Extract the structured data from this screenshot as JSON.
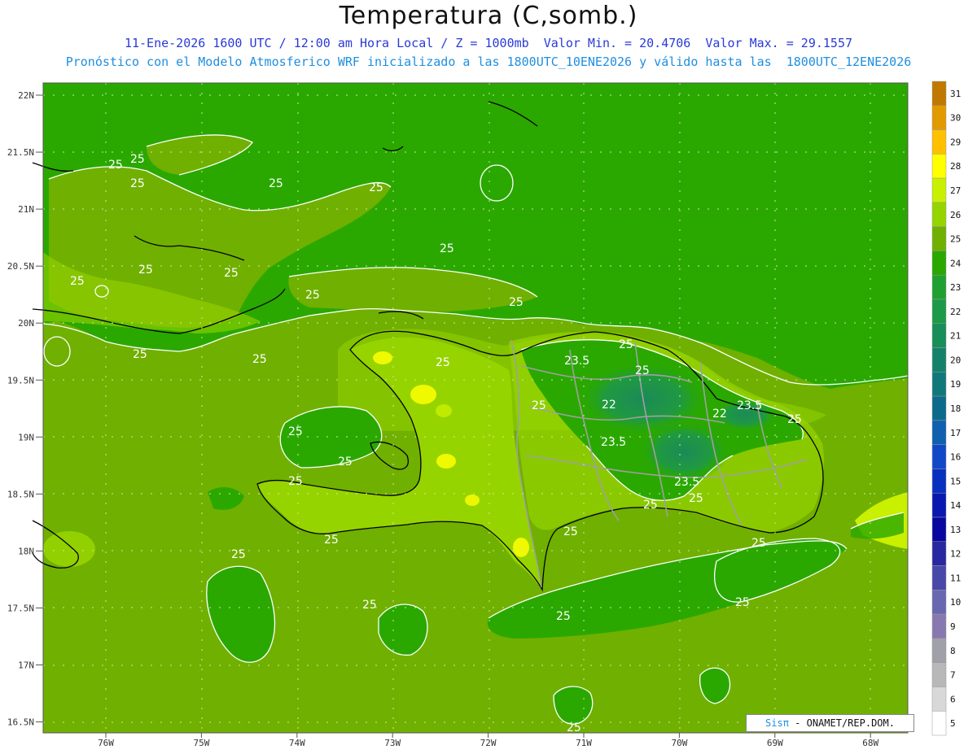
{
  "header": {
    "title": "Temperatura (C,somb.)",
    "subtitle1": "11-Ene-2026 1600 UTC / 12:00 am Hora Local / Z = 1000mb  Valor Min. = 20.4706  Valor Max. = 29.1557",
    "subtitle2": "Pronóstico con el Modelo Atmosferico WRF inicializado a las 1800UTC_10ENE2026 y válido hasta las  1800UTC_12ENE2026"
  },
  "axes": {
    "lat_labels": [
      "22N",
      "21.5N",
      "21N",
      "20.5N",
      "20N",
      "19.5N",
      "19N",
      "18.5N",
      "18N",
      "17.5N",
      "17N",
      "16.5N"
    ],
    "lon_labels": [
      "76W",
      "75W",
      "74W",
      "73W",
      "72W",
      "71W",
      "70W",
      "69W",
      "68W"
    ],
    "lat_values": [
      22,
      21.5,
      21,
      20.5,
      20,
      19.5,
      19,
      18.5,
      18,
      17.5,
      17,
      16.5
    ],
    "lon_values": [
      -76,
      -75,
      -74,
      -73,
      -72,
      -71,
      -70,
      -69,
      -68
    ]
  },
  "contour_labels": [
    "25",
    "25",
    "25",
    "25",
    "25",
    "25",
    "25",
    "25",
    "25",
    "25",
    "25",
    "25",
    "25",
    "25",
    "25",
    "25",
    "25",
    "25",
    "25",
    "25",
    "25",
    "25",
    "25",
    "25",
    "25",
    "25",
    "25",
    "25",
    "23.5",
    "23.5",
    "23.5",
    "23.5",
    "22",
    "22"
  ],
  "colorbar": {
    "labels": [
      "31",
      "30",
      "29",
      "28",
      "27",
      "26",
      "25",
      "24",
      "23",
      "22",
      "21",
      "20",
      "19",
      "18",
      "17",
      "16",
      "15",
      "14",
      "13",
      "12",
      "11",
      "10",
      "9",
      "8",
      "7",
      "6",
      "5"
    ],
    "colors": [
      "#c07800",
      "#e39a00",
      "#ffc000",
      "#ffff00",
      "#c8f000",
      "#96d400",
      "#70b000",
      "#2aa800",
      "#20a030",
      "#1c9a48",
      "#188e5a",
      "#14826a",
      "#10787a",
      "#0c6a8a",
      "#1060b0",
      "#1048c8",
      "#0830c0",
      "#0818b0",
      "#0808a0",
      "#2828a0",
      "#4848a8",
      "#6868b0",
      "#8878b0",
      "#a0a0a8",
      "#b8b8b8",
      "#d8d8d8",
      "#ffffff"
    ]
  },
  "credit": {
    "brand": "Sisπ",
    "text": " - ONAMET/REP.DOM."
  }
}
